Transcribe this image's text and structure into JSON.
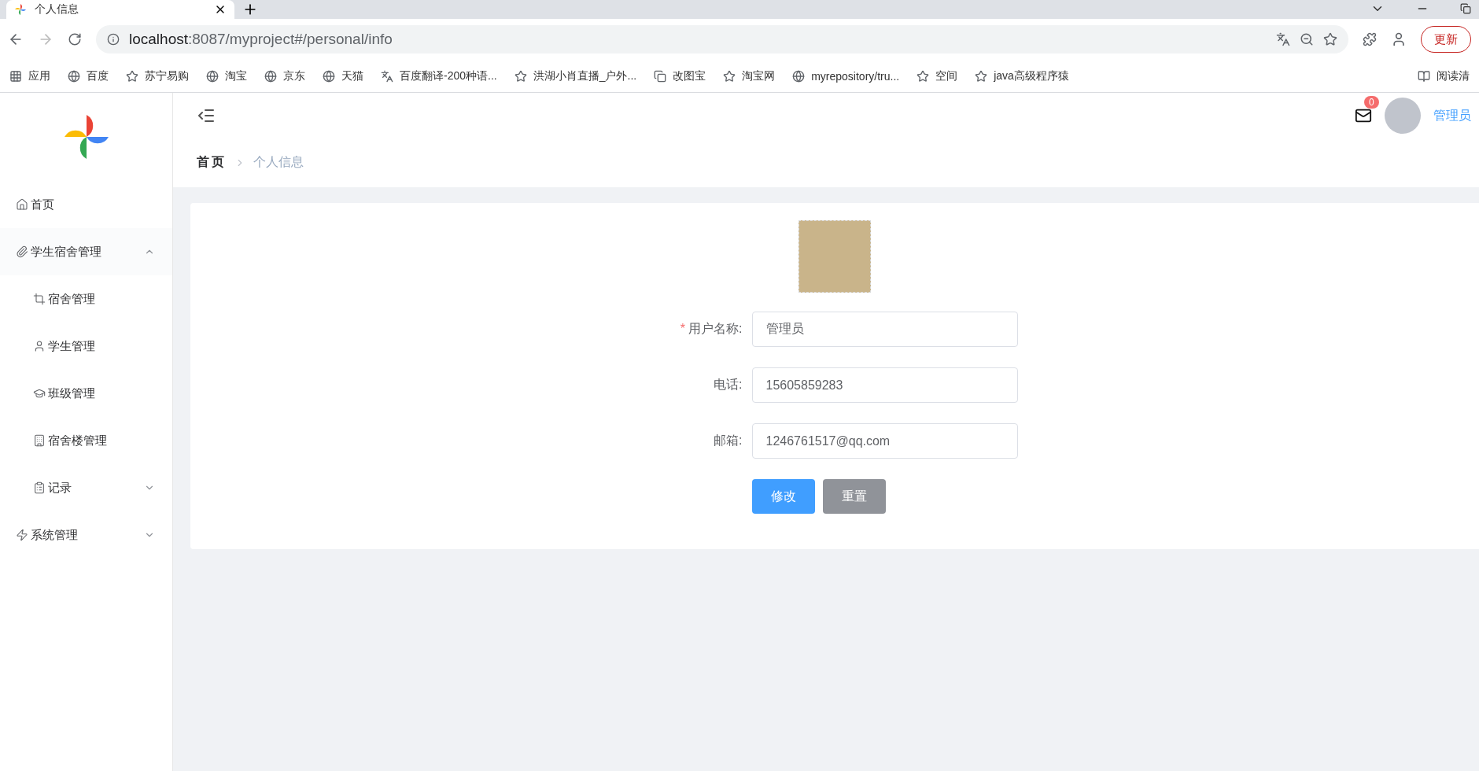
{
  "browser": {
    "tab_title": "个人信息",
    "address_host": "localhost",
    "address_path": ":8087/myproject#/personal/info",
    "update_button": "更新",
    "bookmarks": [
      {
        "label": "应用"
      },
      {
        "label": "百度"
      },
      {
        "label": "苏宁易购"
      },
      {
        "label": "淘宝"
      },
      {
        "label": "京东"
      },
      {
        "label": "天猫"
      },
      {
        "label": "百度翻译-200种语..."
      },
      {
        "label": "洪湖小肖直播_户外..."
      },
      {
        "label": "改图宝"
      },
      {
        "label": "淘宝网"
      },
      {
        "label": "myrepository/tru..."
      },
      {
        "label": "空间"
      },
      {
        "label": "java高级程序猿"
      }
    ],
    "reading_list": "阅读清"
  },
  "sidebar": {
    "menu": [
      {
        "label": "首页"
      },
      {
        "label": "学生宿舍管理",
        "expanded": true,
        "children": [
          {
            "label": "宿舍管理"
          },
          {
            "label": "学生管理"
          },
          {
            "label": "班级管理"
          },
          {
            "label": "宿舍楼管理"
          },
          {
            "label": "记录",
            "expanded": false
          }
        ]
      },
      {
        "label": "系统管理",
        "expanded": false
      }
    ]
  },
  "header": {
    "notification_count": "0",
    "user_name": "管理员"
  },
  "breadcrumb": [
    {
      "label": "首页",
      "current": false
    },
    {
      "label": "个人信息",
      "current": true
    }
  ],
  "form": {
    "fields": [
      {
        "label": "用户名称:",
        "value": "管理员",
        "required_mark": "*"
      },
      {
        "label": "电话:",
        "value": "15605859283"
      },
      {
        "label": "邮箱:",
        "value": "1246761517@qq.com"
      }
    ],
    "buttons": [
      {
        "label": "修改",
        "kind": "primary"
      },
      {
        "label": "重置",
        "kind": "secondary"
      }
    ]
  }
}
